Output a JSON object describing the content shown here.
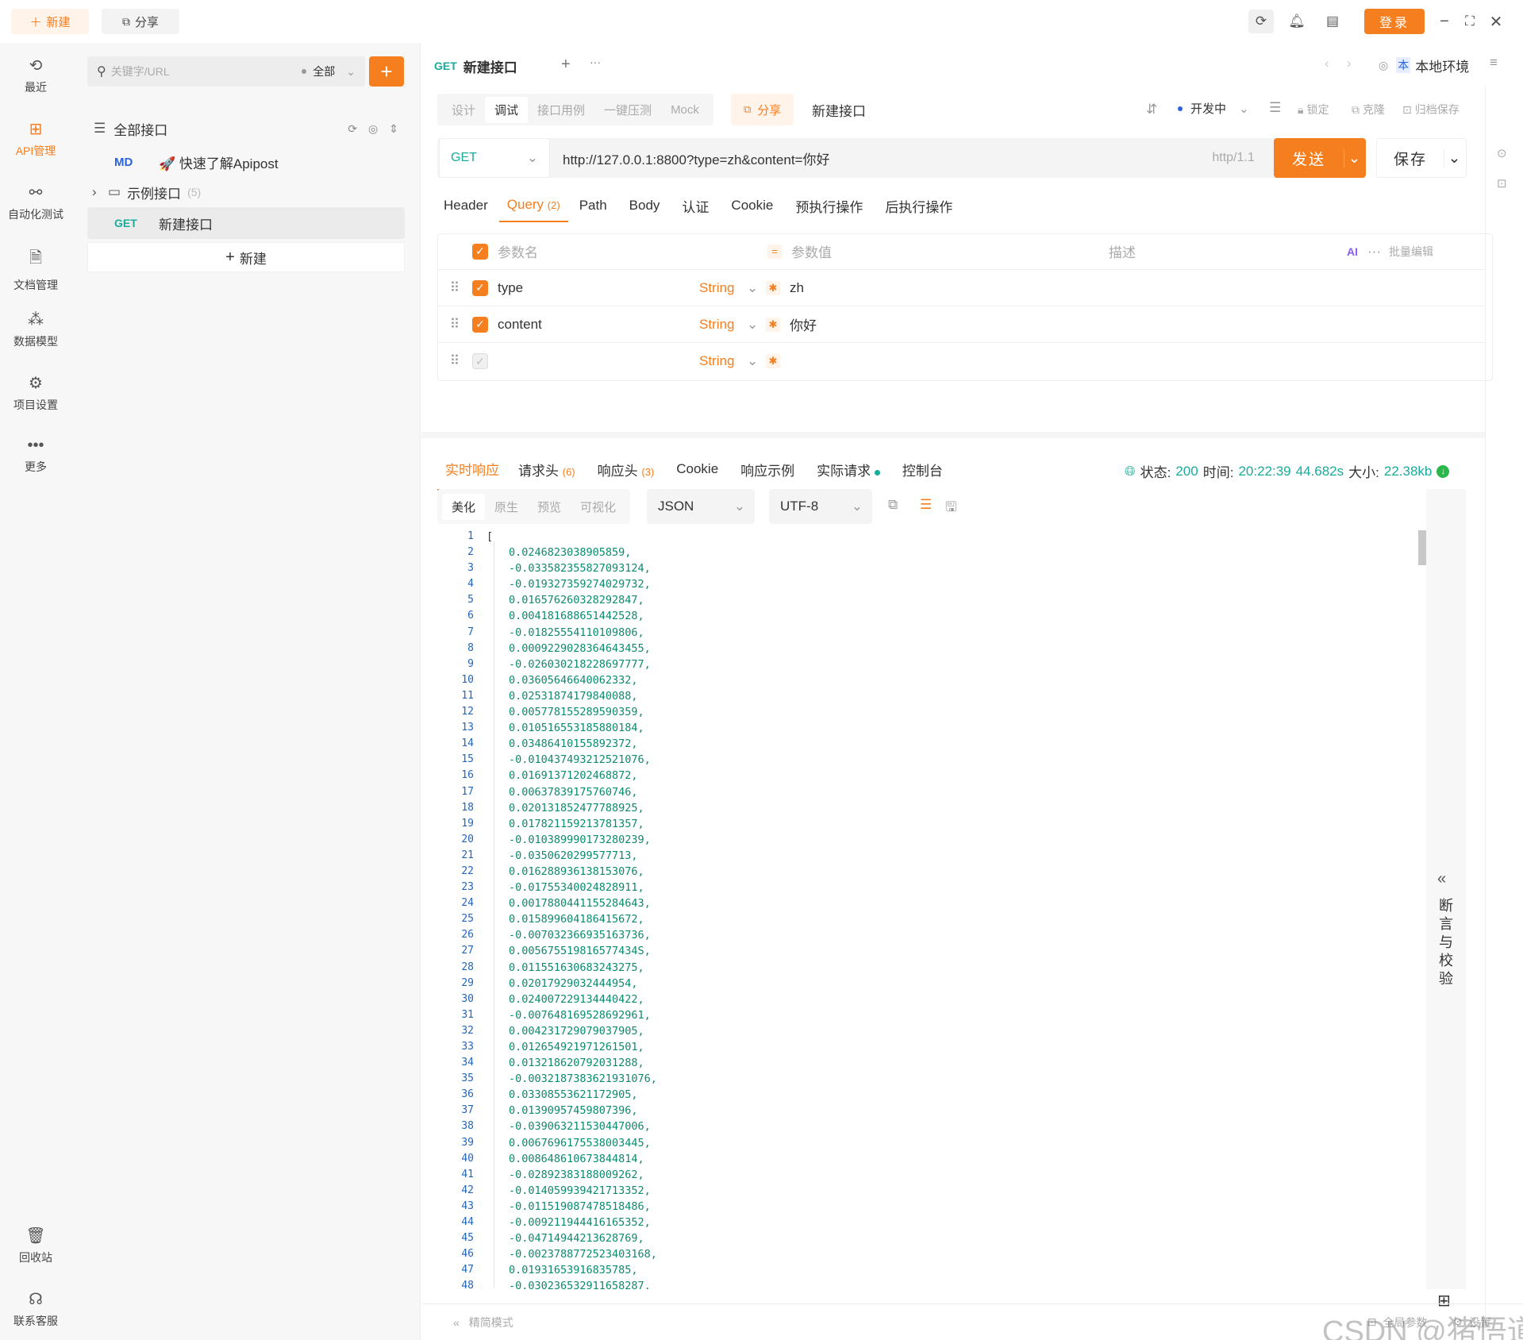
{
  "topbar": {
    "new_label": "新建",
    "share_label": "分享",
    "login_label": "登录"
  },
  "leftnav": {
    "items": [
      {
        "label": "最近",
        "icon": "history-icon"
      },
      {
        "label": "API管理",
        "icon": "api-icon"
      },
      {
        "label": "自动化测试",
        "icon": "automation-icon"
      },
      {
        "label": "文档管理",
        "icon": "document-icon"
      },
      {
        "label": "数据模型",
        "icon": "model-icon"
      },
      {
        "label": "项目设置",
        "icon": "settings-icon"
      },
      {
        "label": "更多",
        "icon": "more-icon"
      }
    ],
    "recycle_label": "回收站",
    "support_label": "联系客服"
  },
  "tree": {
    "search_placeholder": "关键字/URL",
    "filter_label": "全部",
    "root_label": "全部接口",
    "items": [
      {
        "method": "MD",
        "label": "🚀 快速了解Apipost"
      },
      {
        "label": "示例接口",
        "count": "(5)"
      },
      {
        "method": "GET",
        "label": "新建接口"
      }
    ],
    "new_label": "新建"
  },
  "tabbar": {
    "active_method": "GET",
    "active_title": "新建接口",
    "env_label": "本地环境",
    "env_badge": "本"
  },
  "modes": {
    "tabs": [
      "设计",
      "调试",
      "接口用例",
      "一键压测",
      "Mock"
    ],
    "active": "调试",
    "share_label": "分享",
    "api_name": "新建接口",
    "status_label": "开发中",
    "lock_label": "锁定",
    "clone_label": "克隆",
    "archive_label": "归档保存"
  },
  "request": {
    "method": "GET",
    "url": "http://127.0.0.1:8800?type=zh&content=你好",
    "protocol": "http/1.1",
    "send_label": "发送",
    "save_label": "保存"
  },
  "req_tabs": [
    {
      "label": "Header"
    },
    {
      "label": "Query",
      "count": "(2)"
    },
    {
      "label": "Path"
    },
    {
      "label": "Body"
    },
    {
      "label": "认证"
    },
    {
      "label": "Cookie"
    },
    {
      "label": "预执行操作"
    },
    {
      "label": "后执行操作"
    }
  ],
  "params": {
    "header_name": "参数名",
    "header_value": "参数值",
    "header_desc": "描述",
    "ai_label": "AI",
    "bulk_label": "批量编辑",
    "rows": [
      {
        "name": "type",
        "type": "String",
        "value": "zh"
      },
      {
        "name": "content",
        "type": "String",
        "value": "你好"
      },
      {
        "name": "",
        "type": "String",
        "value": ""
      }
    ]
  },
  "resp_tabs": [
    {
      "label": "实时响应"
    },
    {
      "label": "请求头",
      "count": "(6)"
    },
    {
      "label": "响应头",
      "count": "(3)"
    },
    {
      "label": "Cookie"
    },
    {
      "label": "响应示例"
    },
    {
      "label": "实际请求"
    },
    {
      "label": "控制台"
    }
  ],
  "resp_status": {
    "status_label": "状态:",
    "status": "200",
    "time_label": "时间:",
    "time": "20:22:39",
    "duration": "44.682s",
    "size_label": "大小:",
    "size": "22.38kb"
  },
  "view": {
    "tabs": [
      "美化",
      "原生",
      "预览",
      "可视化"
    ],
    "format": "JSON",
    "encoding": "UTF-8"
  },
  "side_panel": {
    "label_chars": [
      "断",
      "言",
      "与",
      "校",
      "验"
    ]
  },
  "code_lines": [
    "[",
    "0.0246823038905859,",
    "-0.033582355827093124,",
    "-0.019327359274029732,",
    "0.016576260328292847,",
    "0.004181688651442528,",
    "-0.01825554110109806,",
    "0.0009229028364643455,",
    "-0.026030218228697777,",
    "0.03605646640062332,",
    "0.02531874179840088,",
    "0.005778155289590359,",
    "0.010516553185880184,",
    "0.03486410155892372,",
    "-0.010437493212521076,",
    "0.01691371202468872,",
    "0.00637839175760746,",
    "0.020131852477788925,",
    "0.017821159213781357,",
    "-0.010389990173280239,",
    "-0.0350620299577713,",
    "0.016288936138153076,",
    "-0.01755340024828911,",
    "0.0017880441155284643,",
    "0.015899604186415672,",
    "-0.007032366935163736,",
    "0.005675519816577434S,",
    "0.011551630683243275,",
    "0.02017929032444954,",
    "0.024007229134440422,",
    "-0.007648169528692961,",
    "0.004231729079037905,",
    "0.012654921971261501,",
    "0.013218620792031288,",
    "-0.0032187383621931076,",
    "0.03308553621172905,",
    "0.01390957459807396,",
    "-0.039063211530447006,",
    "0.0067696175538003445,",
    "0.008648610673844814,",
    "-0.02892383188009262,",
    "-0.014059939421713352,",
    "-0.011519087478518486,",
    "-0.009211944416165352,",
    "-0.04714944213628769,",
    "-0.0023788772523403168,",
    "0.01931653916835785,",
    "-0.030236532911658287,"
  ],
  "footer": {
    "simple_mode": "精简模式",
    "global_params": "全局参数",
    "settings": "设置",
    "watermark": "CSDN @猪悟道"
  },
  "colors": {
    "accent": "#f57e1f",
    "green": "#1aab9b",
    "number": "#0b8a6f"
  }
}
